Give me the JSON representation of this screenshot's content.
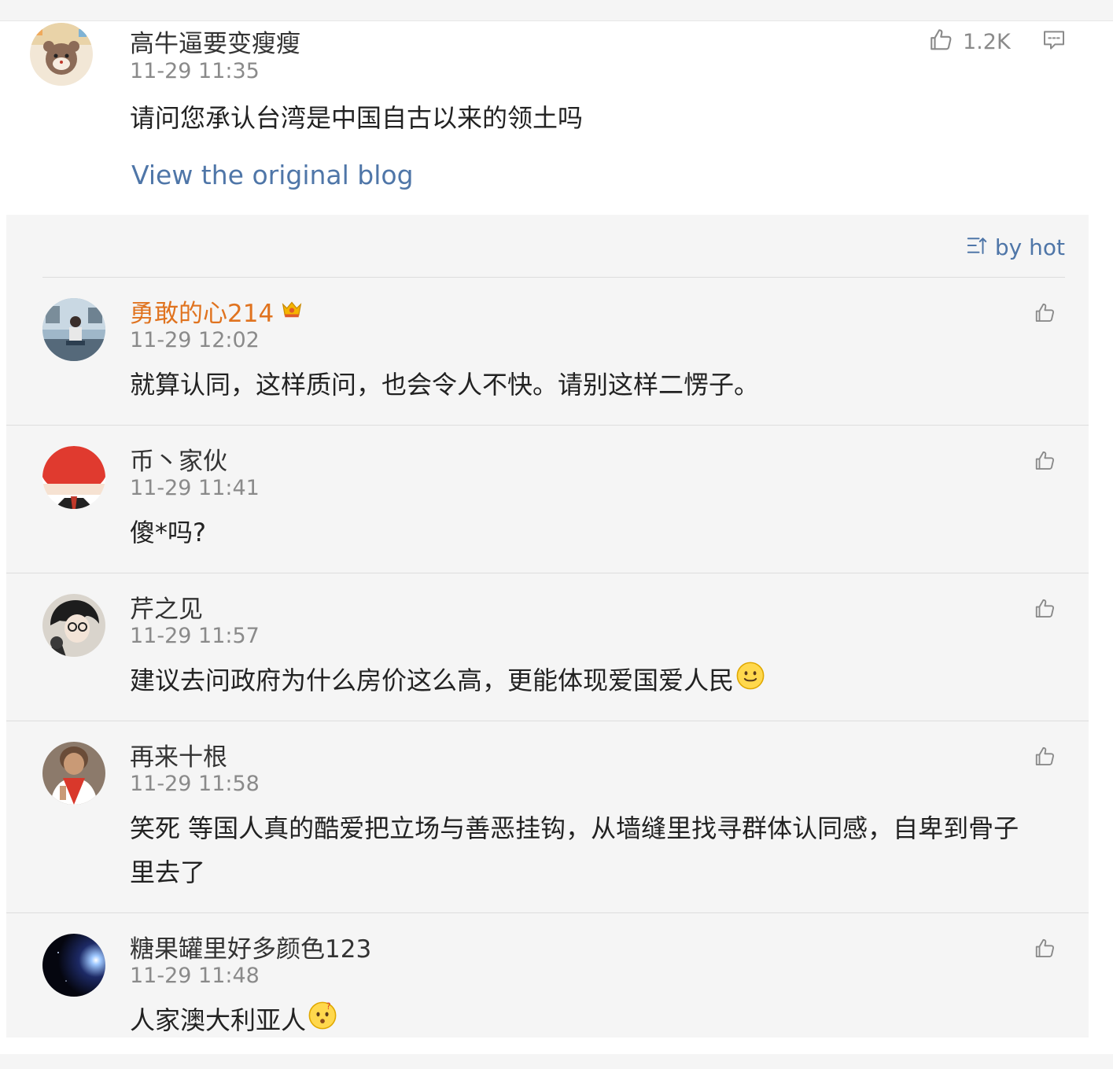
{
  "post": {
    "author": "高牛逼要变瘦瘦",
    "time": "11-29 11:35",
    "text": "请问您承认台湾是中国自古以来的领土吗",
    "view_original_label": "View the original blog",
    "likes": "1.2K",
    "like_icon": "thumbs-up-icon",
    "comment_icon": "comment-icon"
  },
  "comments_panel": {
    "sort_label": "by hot",
    "sort_icon": "sort-icon"
  },
  "comments": [
    {
      "name": "勇敢的心214",
      "time": "11-29 12:02",
      "text": "就算认同，这样质问，也会令人不快。请别这样二愣子。",
      "badge": "crown-icon"
    },
    {
      "name": "币丶家伙",
      "time": "11-29 11:41",
      "text": "傻*吗?"
    },
    {
      "name": "芹之见",
      "time": "11-29 11:57",
      "text": "建议去问政府为什么房价这么高，更能体现爱国爱人民",
      "emoji": "smile-emoji"
    },
    {
      "name": "再来十根",
      "time": "11-29 11:58",
      "text": "笑死 等国人真的酷爱把立场与善恶挂钩，从墙缝里找寻群体认同感，自卑到骨子里去了"
    },
    {
      "name": "糖果罐里好多颜色123",
      "time": "11-29 11:48",
      "text": "人家澳大利亚人",
      "emoji": "confused-emoji"
    }
  ],
  "colors": {
    "link": "#4f76a8",
    "vip_name": "#e0731f",
    "muted": "#8a8a8a",
    "panel_bg": "#f5f5f5"
  }
}
